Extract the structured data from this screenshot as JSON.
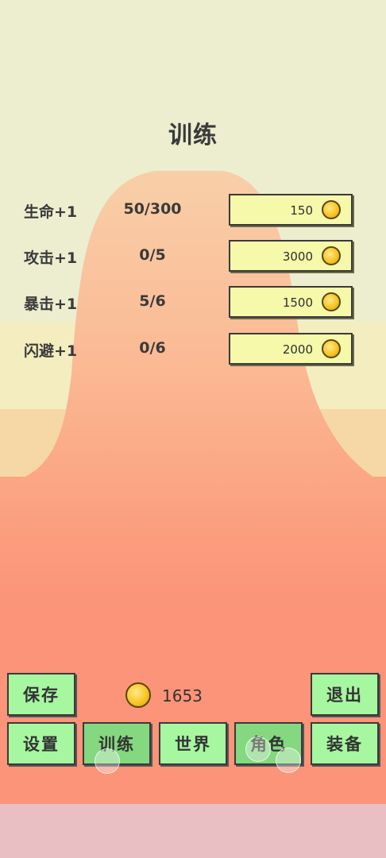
{
  "title": "训练",
  "stats": [
    {
      "label": "生命+1",
      "value": "50/300",
      "cost": "150"
    },
    {
      "label": "攻击+1",
      "value": "0/5",
      "cost": "3000"
    },
    {
      "label": "暴击+1",
      "value": "5/6",
      "cost": "1500"
    },
    {
      "label": "闪避+1",
      "value": "0/6",
      "cost": "2000"
    }
  ],
  "wallet": {
    "coins": "1653"
  },
  "buttons": {
    "save": "保存",
    "exit": "退出",
    "settings": "设置",
    "train": "训练",
    "world": "世界",
    "role": "角色",
    "equip": "装备"
  },
  "icons": {
    "coin": "gold-coin-icon"
  },
  "colors": {
    "sky_top": "#eceecf",
    "sky_mid": "#f3edc0",
    "sand": "#f6d8a6",
    "ground": "#fb9478",
    "mountain": "#f8c6a6",
    "button_green": "#a6f7a0",
    "button_green_selected": "#84d880",
    "buy_yellow": "#f6f8aa",
    "footer_pink": "#e9bfc3"
  }
}
